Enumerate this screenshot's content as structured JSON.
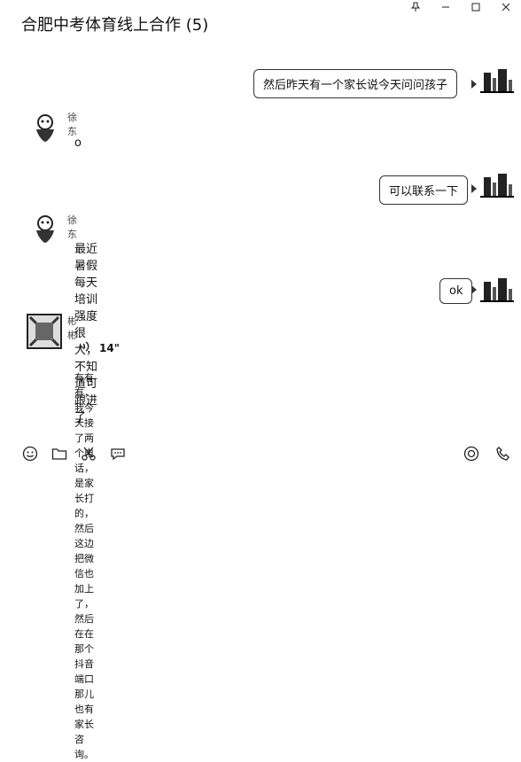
{
  "window": {
    "title": "合肥中考体育线上合作 (5)",
    "controls": [
      "pin",
      "minimize",
      "maximize",
      "close"
    ]
  },
  "messages": [
    {
      "side": "right",
      "text": "然后昨天有一个家长说今天问问孩子"
    },
    {
      "side": "left",
      "sender": "徐东",
      "text": "o"
    },
    {
      "side": "right",
      "text": "可以联系一下"
    },
    {
      "side": "left",
      "sender": "徐东",
      "text": "最近暑假每天培训强度很大，不知道可跟进了"
    },
    {
      "side": "right",
      "text": "ok"
    },
    {
      "side": "left",
      "sender": "彬彬",
      "voice": {
        "duration": "14\""
      },
      "text": "有有有，我今天接了两个电话，是家长打的，\n然后这边把微信也加上了，然后在在那个抖音\n端口那儿也有家长咨询。"
    }
  ],
  "toolbar": {
    "left": [
      "emoji-icon",
      "folder-icon",
      "scissors-icon",
      "chat-bubble-icon"
    ],
    "right": [
      "live-icon",
      "phone-icon"
    ]
  }
}
